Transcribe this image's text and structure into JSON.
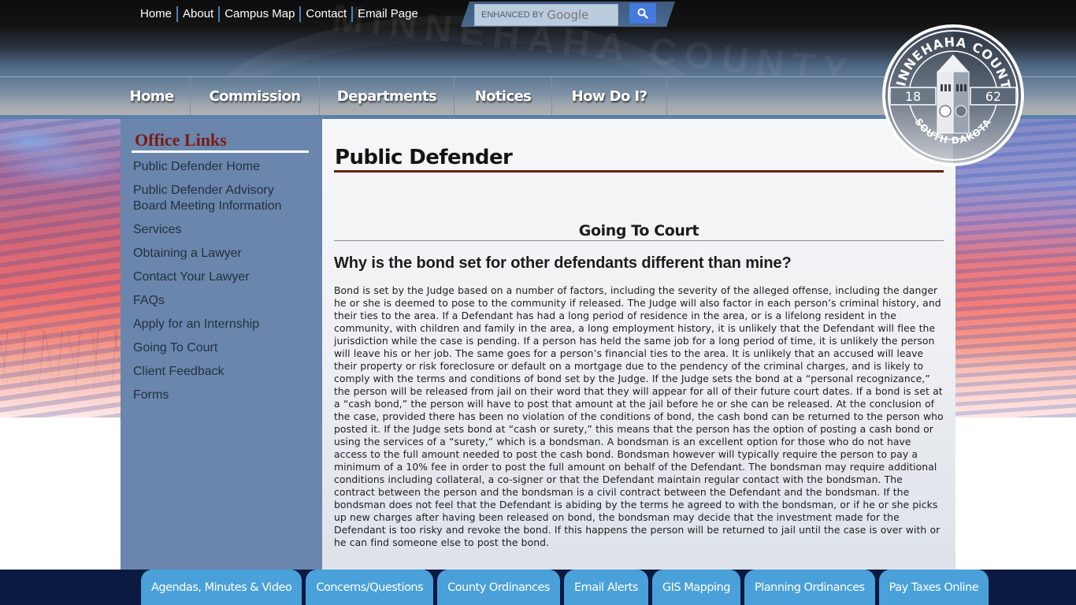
{
  "utility_nav": {
    "items": [
      "Home",
      "About",
      "Campus Map",
      "Contact",
      "Email Page"
    ]
  },
  "search": {
    "placeholder_prefix": "ENHANCED BY",
    "placeholder_brand": "Google",
    "button_icon": "search-icon"
  },
  "main_nav": {
    "items": [
      "Home",
      "Commission",
      "Departments",
      "Notices",
      "How Do I?"
    ]
  },
  "seal": {
    "top_text": "MINNEHAHA COUNTY",
    "bottom_text": "SOUTH DAKOTA",
    "year_left": "18",
    "year_right": "62"
  },
  "sidebar": {
    "title": "Office Links",
    "items": [
      "Public Defender Home",
      "Public Defender Advisory Board Meeting Information",
      "Services",
      "Obtaining a Lawyer",
      "Contact Your Lawyer",
      "FAQs",
      "Apply for an Internship",
      "Going To Court",
      "Client Feedback",
      "Forms"
    ]
  },
  "main": {
    "page_title": "Public Defender",
    "section_title": "Going To Court",
    "question": "Why is the bond set for other defendants different than mine?",
    "answer": "Bond is set by the Judge based on a number of factors, including the severity of the alleged offense, including the danger he or she is deemed to pose to the community if released.  The Judge will also factor in each person’s criminal history, and their ties to the area.   If a Defendant has had a long period of residence in the area, or is a lifelong resident in the community, with children and family in the area, a long employment history, it is unlikely that the Defendant will flee the jurisdiction while the case is pending.  If a person has held the same job for a long period of time, it is unlikely the person will leave his or her job.  The same goes for a person’s financial ties to the area.  It is unlikely that an accused will leave their property or risk foreclosure or default on a mortgage due to the pendency of the criminal charges, and is likely to comply with the terms and conditions of bond set by the Judge.   If the Judge sets the bond at a “personal recognizance,” the person will be released from jail on their word that they will appear for all of their future court dates.  If a bond is set at a “cash bond,” the person will have to post that amount at the jail before he or she can be released.  At the conclusion of the case, provided there has been no violation of the conditions of bond, the cash bond can be returned to the person who posted it.  If the Judge sets bond at “cash or surety,” this means that the person has the option of posting a cash bond or using the services of a “surety,” which is a bondsman.  A bondsman is an excellent option for those who do not have access to the full amount needed to post the cash bond.  Bondsman however will typically require the person to pay a minimum of a 10% fee in order to post the full amount on behalf of the Defendant.  The bondsman may require additional conditions including collateral, a co-signer or that the Defendant maintain regular contact with the bondsman.    The contract between the person and the bondsman is a civil contract between the Defendant and the bondsman.  If the bondsman does not feel that the Defendant is abiding by the terms he agreed to with the bondsman, or if he or she picks up new charges after having been released on bond, the bondsman may decide that the investment made for the Defendant is too risky and revoke the bond.  If this happens the person will be returned to jail until the case is over with or he can find someone else to post the bond."
  },
  "footer": {
    "quick_links": [
      "Agendas, Minutes & Video",
      "Concerns/Questions",
      "County Ordinances",
      "Email Alerts",
      "GIS Mapping",
      "Planning Ordinances",
      "Pay Taxes Online"
    ]
  },
  "colors": {
    "sidebar_bg": "#6a86ad",
    "sidebar_title": "#7a1a12",
    "title_rule": "#6b1f11",
    "footer_bg": "#0b1a40",
    "quick_link_bg": "#4aa0d9",
    "search_button": "#4479de"
  }
}
